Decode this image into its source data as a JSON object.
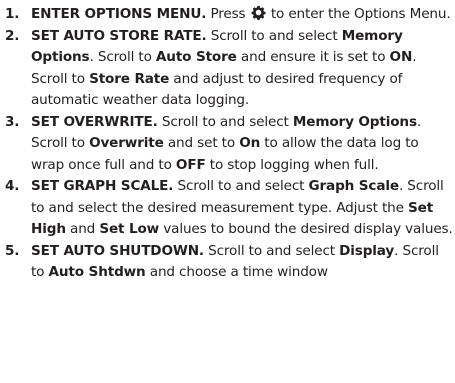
{
  "steps": [
    {
      "number": "1.",
      "heading": "ENTER OPTIONS MENU.",
      "text_before_icon": " Press ",
      "icon": "gear-icon",
      "text_after_icon": " to enter the Options Menu."
    },
    {
      "number": "2.",
      "heading": "SET AUTO STORE RATE.",
      "parts": [
        {
          "t": " Scroll to and select ",
          "b": false
        },
        {
          "t": "Memory Options",
          "b": true
        },
        {
          "t": ". Scroll to ",
          "b": false
        },
        {
          "t": "Auto Store",
          "b": true
        },
        {
          "t": " and ensure it is set to ",
          "b": false
        },
        {
          "t": "ON",
          "b": true
        },
        {
          "t": ". Scroll to ",
          "b": false
        },
        {
          "t": "Store Rate",
          "b": true
        },
        {
          "t": " and adjust to desired frequency of automatic weather data logging.",
          "b": false
        }
      ]
    },
    {
      "number": "3.",
      "heading": "SET OVERWRITE.",
      "parts": [
        {
          "t": " Scroll to and select ",
          "b": false
        },
        {
          "t": "Memory Options",
          "b": true
        },
        {
          "t": ". Scroll to ",
          "b": false
        },
        {
          "t": "Overwrite",
          "b": true
        },
        {
          "t": " and set to ",
          "b": false
        },
        {
          "t": "On",
          "b": true
        },
        {
          "t": " to allow the data log to wrap once full and to ",
          "b": false
        },
        {
          "t": "OFF",
          "b": true
        },
        {
          "t": " to stop logging when full.",
          "b": false
        }
      ]
    },
    {
      "number": "4.",
      "heading": "SET GRAPH SCALE.",
      "parts": [
        {
          "t": " Scroll to and select ",
          "b": false
        },
        {
          "t": "Graph Scale",
          "b": true
        },
        {
          "t": ". Scroll to and select the desired measurement type. Adjust the ",
          "b": false
        },
        {
          "t": "Set High",
          "b": true
        },
        {
          "t": " and ",
          "b": false
        },
        {
          "t": "Set Low",
          "b": true
        },
        {
          "t": " values to bound the desired display values.",
          "b": false
        }
      ]
    },
    {
      "number": "5.",
      "heading": "SET AUTO SHUTDOWN.",
      "parts": [
        {
          "t": " Scroll to and select ",
          "b": false
        },
        {
          "t": "Display",
          "b": true
        },
        {
          "t": ". Scroll to ",
          "b": false
        },
        {
          "t": "Auto Shtdwn",
          "b": true
        },
        {
          "t": " and choose a time window",
          "b": false
        }
      ]
    }
  ]
}
